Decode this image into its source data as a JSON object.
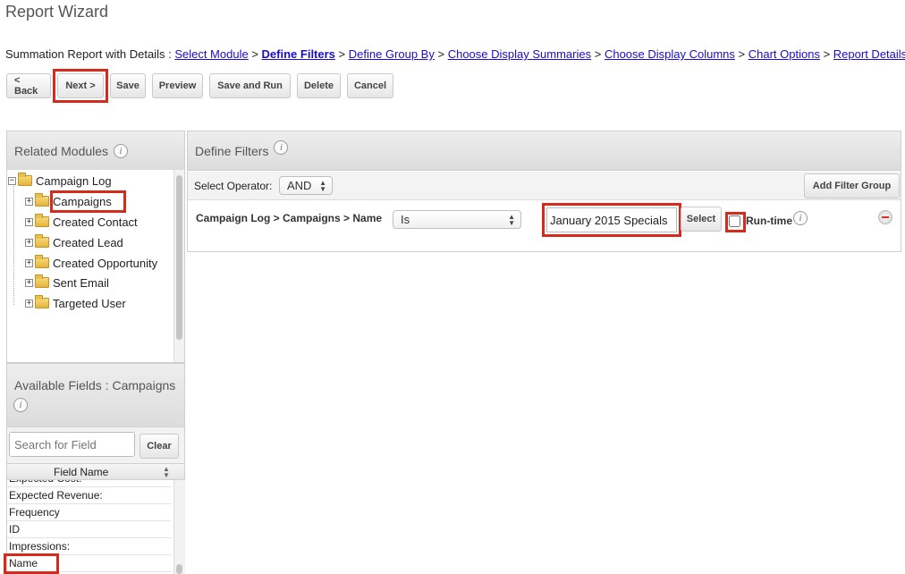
{
  "page": {
    "title": "Report Wizard"
  },
  "breadcrumb": {
    "prefix": "Summation Report with Details :",
    "separator": ">",
    "steps": [
      "Select Module",
      "Define Filters",
      "Define Group By",
      "Choose Display Summaries",
      "Choose Display Columns",
      "Chart Options",
      "Report Details"
    ],
    "current_step": "Define Filters"
  },
  "toolbar": {
    "back": "< Back",
    "next": "Next >",
    "save": "Save",
    "preview": "Preview",
    "save_and_run": "Save and Run",
    "delete": "Delete",
    "cancel": "Cancel"
  },
  "related_modules": {
    "title": "Related Modules",
    "root": "Campaign Log",
    "children": [
      "Campaigns",
      "Created Contact",
      "Created Lead",
      "Created Opportunity",
      "Sent Email",
      "Targeted User"
    ]
  },
  "available_fields": {
    "title": "Available Fields : Campaigns",
    "search_placeholder": "Search for Field",
    "clear_label": "Clear",
    "column_header": "Field Name",
    "partial_top_item": "Expected Cost:",
    "items": [
      "Expected Revenue:",
      "Frequency",
      "ID",
      "Impressions:",
      "Name"
    ]
  },
  "define_filters": {
    "title": "Define Filters",
    "operator_label": "Select Operator:",
    "operator_value": "AND",
    "add_filter_group": "Add Filter Group",
    "filter": {
      "field_path": "Campaign Log > Campaigns > Name",
      "operator": "Is",
      "value": "January 2015 Specials",
      "select_label": "Select",
      "runtime_label": "Run-time",
      "runtime_checked": false
    }
  },
  "icons": {
    "info": "info-icon",
    "remove": "remove-filter-icon",
    "tree_expand": "plus-box-icon",
    "folder": "folder-icon"
  },
  "colors": {
    "highlight": "#d52a1c",
    "link": "#1a0dcc",
    "remove_icon": "#d9302a"
  }
}
